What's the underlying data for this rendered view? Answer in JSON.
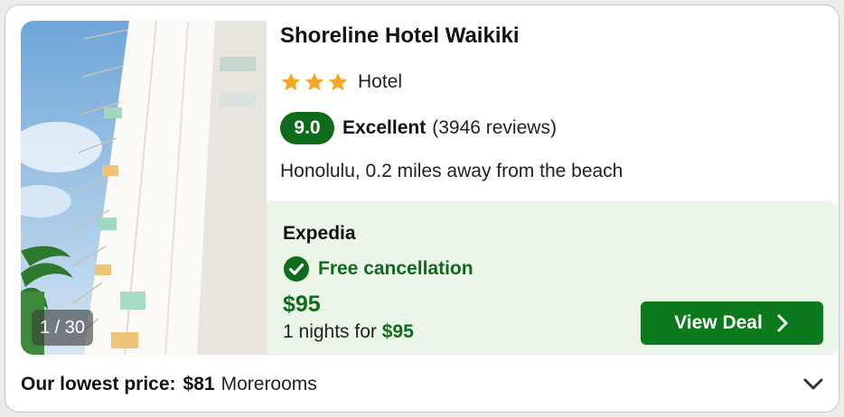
{
  "hotel": {
    "name": "Shoreline Hotel Waikiki",
    "stars": 3,
    "type": "Hotel",
    "score": "9.0",
    "score_label": "Excellent",
    "reviews": "(3946 reviews)",
    "location": "Honolulu, 0.2 miles away from the beach"
  },
  "photo": {
    "counter": "1 / 30",
    "icon": "hotel-photo"
  },
  "deal": {
    "provider": "Expedia",
    "cancellation": "Free cancellation",
    "price": "$95",
    "nights_prefix": "1 nights for",
    "nights_price": "$95",
    "button_label": "View Deal"
  },
  "footer": {
    "lowest_label": "Our lowest price:",
    "lowest_price": "$81",
    "more": "Morerooms"
  },
  "colors": {
    "brand_green": "#0f6b1c",
    "button_green": "#0c7a1c",
    "deal_bg": "#ecf6e8",
    "star": "#f5a623"
  }
}
